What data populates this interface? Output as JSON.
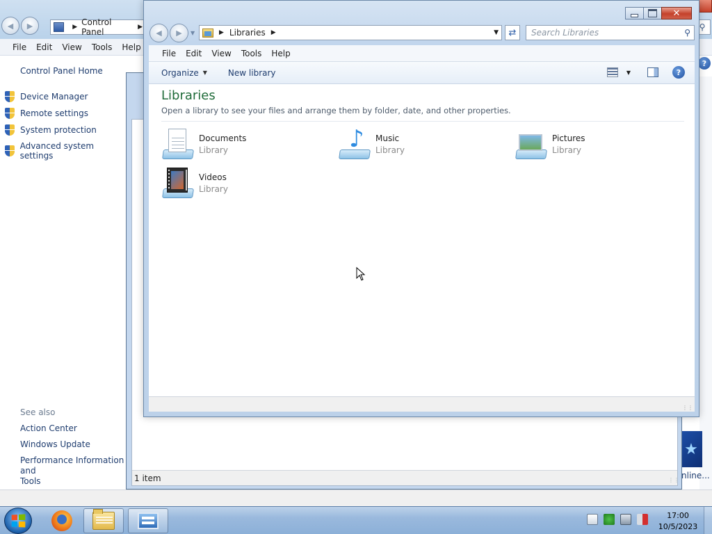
{
  "control_panel": {
    "breadcrumb": "Control Panel",
    "menu": [
      "File",
      "Edit",
      "View",
      "Tools",
      "Help"
    ],
    "home_link": "Control Panel Home",
    "tasks": [
      "Device Manager",
      "Remote settings",
      "System protection",
      "Advanced system settings"
    ],
    "see_also_heading": "See also",
    "see_also_links": [
      "Action Center",
      "Windows Update",
      "Performance Information and\nTools"
    ],
    "banner_text": "nline..."
  },
  "middle_window": {
    "status_text": "1 item"
  },
  "libraries_window": {
    "breadcrumb": "Libraries",
    "search_placeholder": "Search Libraries",
    "menu": [
      "File",
      "Edit",
      "View",
      "Tools",
      "Help"
    ],
    "commands": {
      "organize": "Organize",
      "new_library": "New library"
    },
    "title": "Libraries",
    "subtitle": "Open a library to see your files and arrange them by folder, date, and other properties.",
    "items": [
      {
        "name": "Documents",
        "type": "Library",
        "icon": "documents-library-icon"
      },
      {
        "name": "Music",
        "type": "Library",
        "icon": "music-library-icon"
      },
      {
        "name": "Pictures",
        "type": "Library",
        "icon": "pictures-library-icon"
      },
      {
        "name": "Videos",
        "type": "Library",
        "icon": "videos-library-icon"
      }
    ]
  },
  "taskbar": {
    "clock_time": "17:00",
    "clock_date": "10/5/2023",
    "pinned": [
      "start-orb",
      "firefox",
      "windows-explorer",
      "control-panel"
    ]
  },
  "colors": {
    "title_green": "#1f6b39",
    "link_blue": "#1e3c6e",
    "close_red": "#c4412b"
  }
}
